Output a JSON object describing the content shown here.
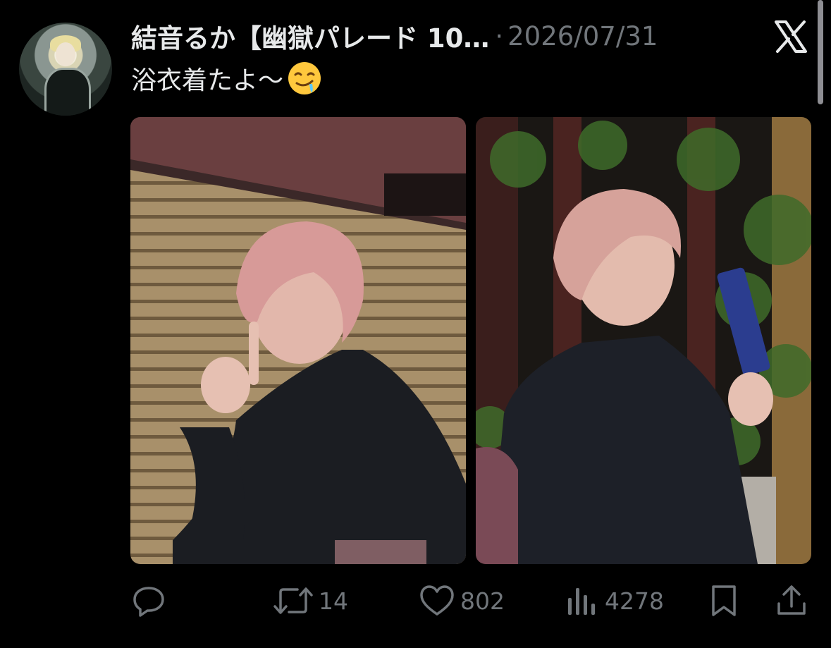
{
  "tweet": {
    "author_name": "結音るか【幽獄パレード 10…",
    "separator": "·",
    "date": "2026/07/31",
    "text": "浴衣着たよ〜",
    "emoji": "drooling-face-emoji"
  },
  "icons": {
    "logo": "x-logo-icon",
    "reply": "reply-icon",
    "retweet": "retweet-icon",
    "like": "like-icon",
    "views": "views-icon",
    "bookmark": "bookmark-icon",
    "share": "share-icon"
  },
  "actions": {
    "reply_count": "",
    "retweet_count": "14",
    "like_count": "802",
    "views_count": "4278"
  },
  "media": {
    "count": 2
  },
  "colors": {
    "background": "#000000",
    "text": "#e7e9ea",
    "muted": "#71767b"
  }
}
